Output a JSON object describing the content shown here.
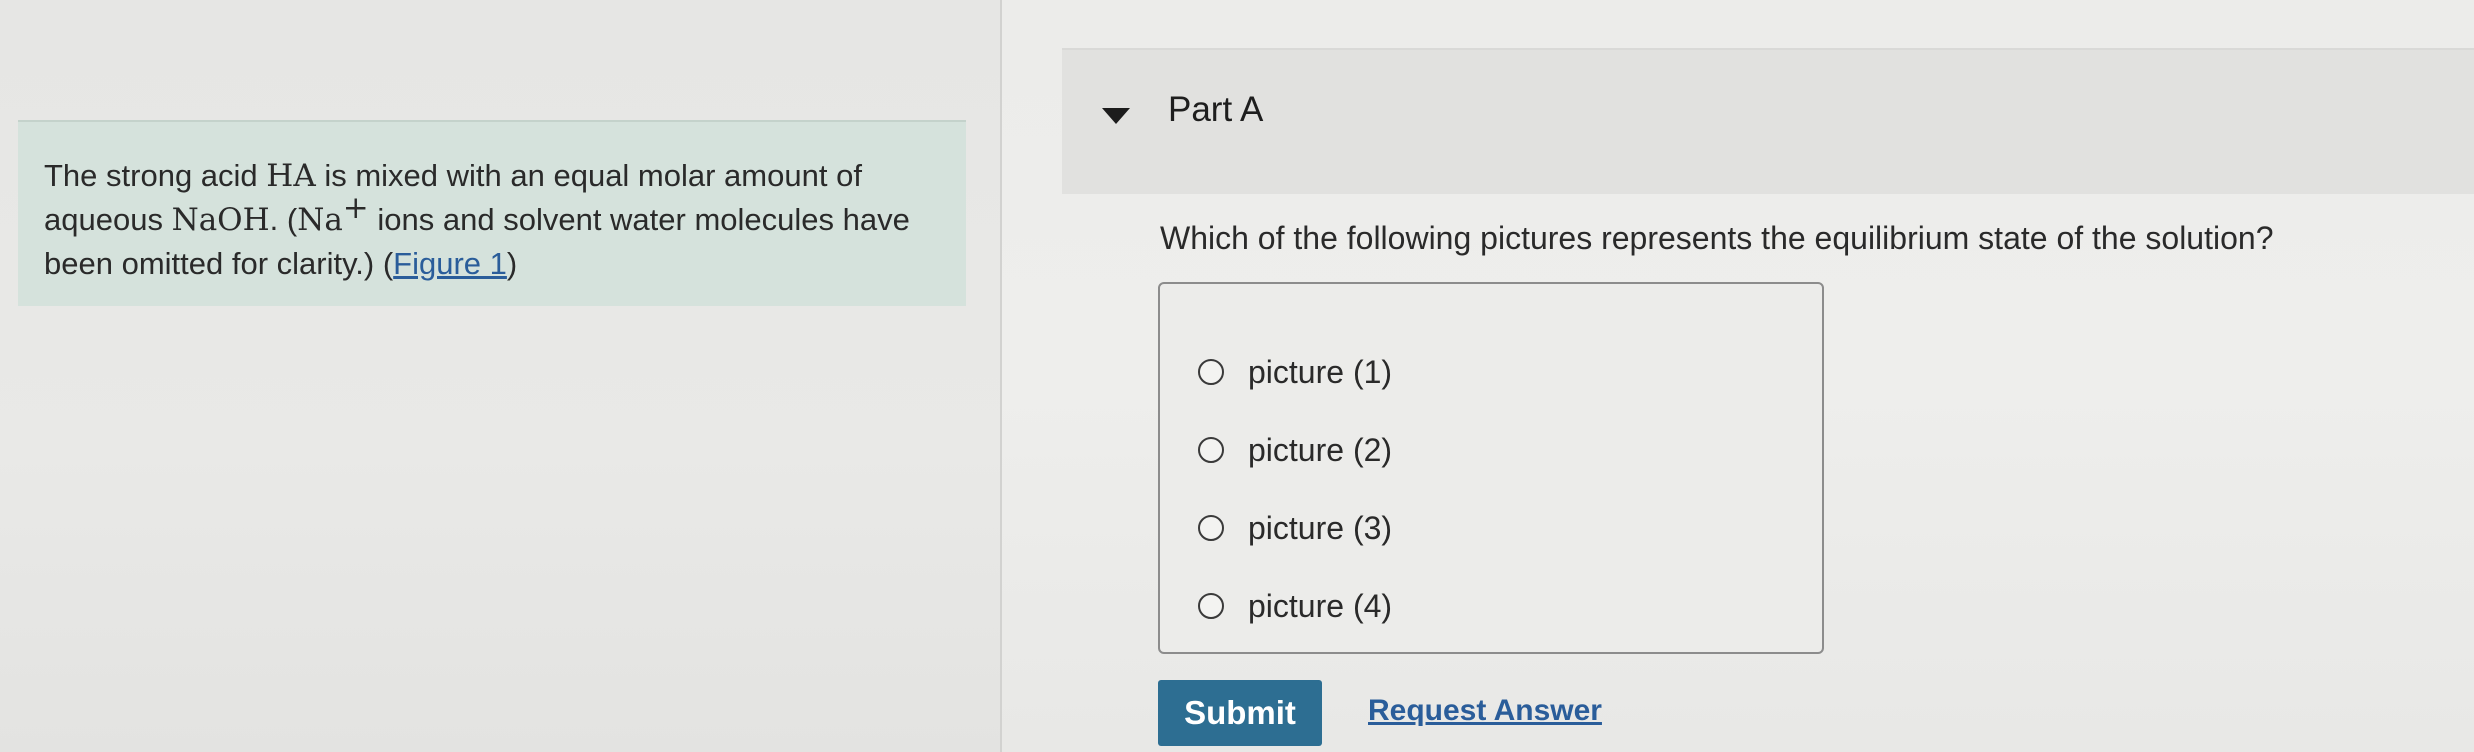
{
  "problem": {
    "text_1": "The strong acid ",
    "math_ha": "HA",
    "text_2": " is mixed with an equal molar amount of aqueous ",
    "math_naoh": "NaOH",
    "text_3": ". (",
    "math_na": "Na",
    "math_na_sup": "+",
    "text_4": " ions and solvent water molecules have been omitted for clarity.) (",
    "figure_link": "Figure 1",
    "text_5": ")"
  },
  "part": {
    "title": "Part A",
    "caret_icon": "caret-down-icon",
    "question": "Which of the following pictures represents the equilibrium state of the solution?"
  },
  "options": [
    {
      "label": "picture (1)"
    },
    {
      "label": "picture (2)"
    },
    {
      "label": "picture (3)"
    },
    {
      "label": "picture (4)"
    }
  ],
  "actions": {
    "submit_label": "Submit",
    "request_label": "Request Answer"
  },
  "colors": {
    "accent": "#2d6e92",
    "link": "#2a5d9a",
    "problem_bg": "#d5e2dc"
  }
}
